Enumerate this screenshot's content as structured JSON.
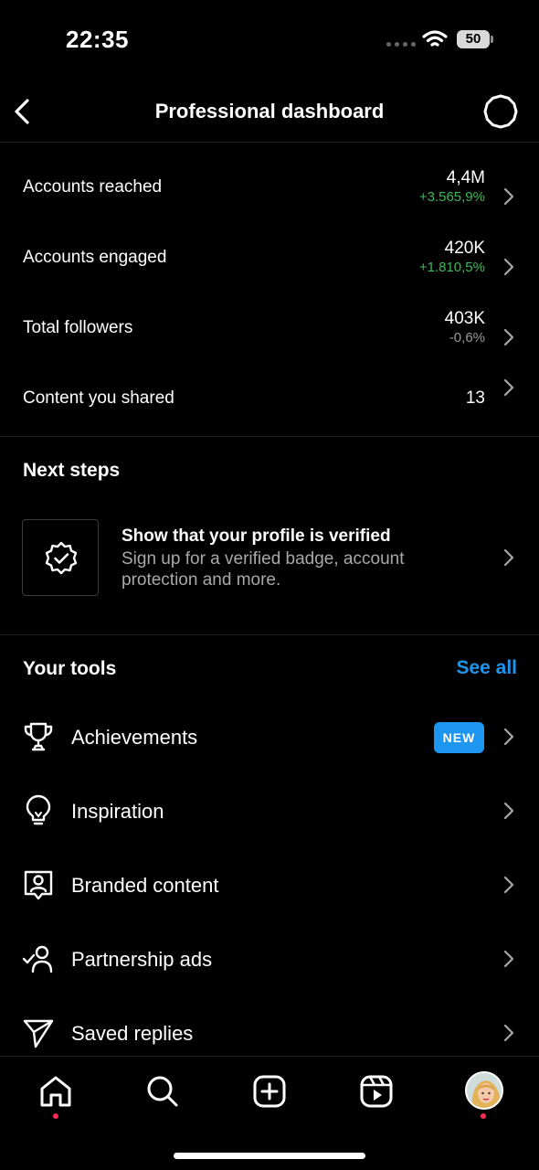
{
  "status_bar": {
    "time": "22:35",
    "battery": "50"
  },
  "header": {
    "title": "Professional dashboard"
  },
  "metrics": [
    {
      "label": "Accounts reached",
      "value": "4,4M",
      "change": "+3.565,9%",
      "trend": "up"
    },
    {
      "label": "Accounts engaged",
      "value": "420K",
      "change": "+1.810,5%",
      "trend": "up"
    },
    {
      "label": "Total followers",
      "value": "403K",
      "change": "-0,6%",
      "trend": "down"
    },
    {
      "label": "Content you shared",
      "value": "13",
      "change": "",
      "trend": "none"
    }
  ],
  "next_steps": {
    "title": "Next steps",
    "card_title": "Show that your profile is verified",
    "card_desc": "Sign up for a verified badge, account protection and more.",
    "icon": "verified-badge-icon"
  },
  "tools": {
    "title": "Your tools",
    "see_all": "See all",
    "items": [
      {
        "label": "Achievements",
        "icon": "trophy-icon",
        "badge": "NEW"
      },
      {
        "label": "Inspiration",
        "icon": "lightbulb-icon"
      },
      {
        "label": "Branded content",
        "icon": "branded-content-icon"
      },
      {
        "label": "Partnership ads",
        "icon": "partnership-icon"
      },
      {
        "label": "Saved replies",
        "icon": "send-icon"
      }
    ]
  },
  "bottom_nav": {
    "items": [
      "home-icon",
      "search-icon",
      "create-icon",
      "reels-icon",
      "profile-avatar"
    ]
  },
  "colors": {
    "accent": "#1d96f0",
    "positive": "#3cb95a",
    "notification": "#ff2a55"
  }
}
